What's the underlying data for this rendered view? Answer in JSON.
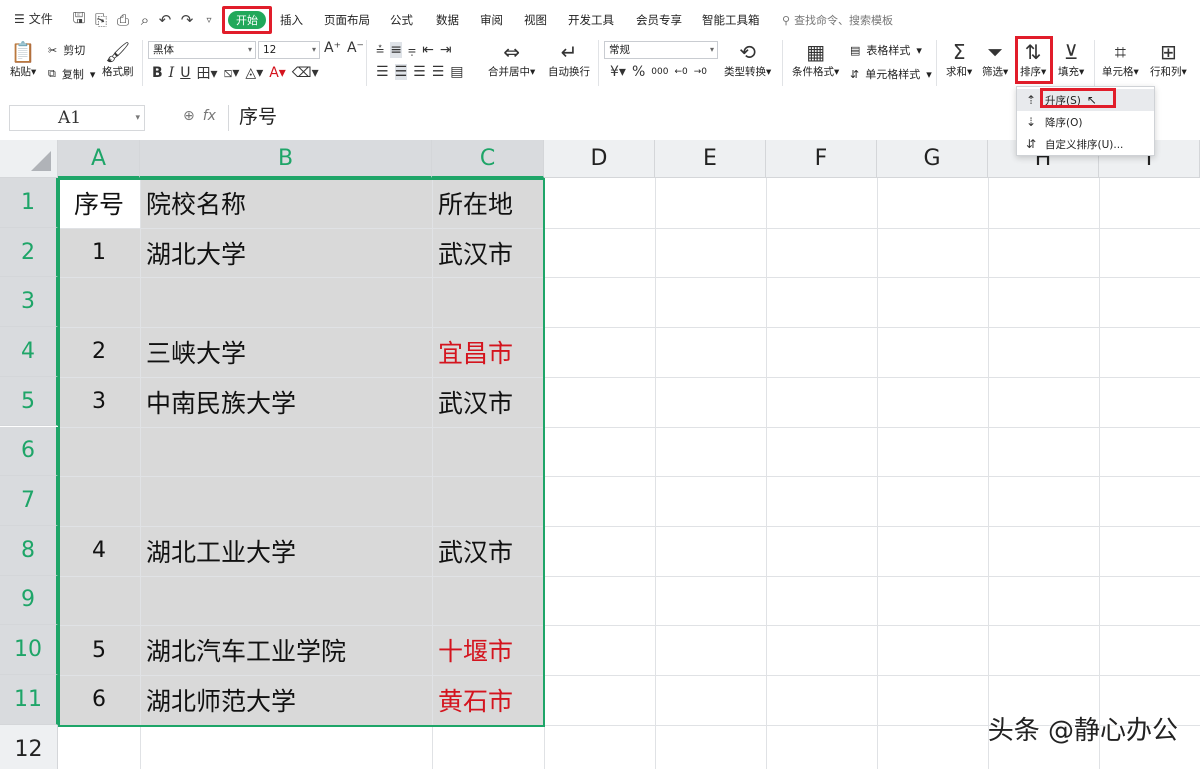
{
  "menubar": {
    "file_label": "文件",
    "tabs": [
      "插入",
      "页面布局",
      "公式",
      "数据",
      "审阅",
      "视图",
      "开发工具",
      "会员专享",
      "智能工具箱"
    ],
    "home_tab": "开始",
    "search_placeholder": "查找命令、搜索模板"
  },
  "ribbon": {
    "paste": "粘贴",
    "cut": "剪切",
    "copy": "复制",
    "format_painter": "格式刷",
    "font_name": "黑体",
    "font_size": "12",
    "merge_center": "合并居中",
    "wrap_text": "自动换行",
    "number_format": "常规",
    "type_convert": "类型转换",
    "conditional_format": "条件格式",
    "table_style": "表格样式",
    "cell_style": "单元格样式",
    "sum": "求和",
    "filter": "筛选",
    "sort": "排序",
    "fill": "填充",
    "cell": "单元格",
    "row_col": "行和列"
  },
  "sort_menu": {
    "ascending": "升序(S)",
    "descending": "降序(O)",
    "custom": "自定义排序(U)..."
  },
  "formula_bar": {
    "name_box": "A1",
    "content": "序号"
  },
  "grid": {
    "columns": [
      "A",
      "B",
      "C",
      "D",
      "E",
      "F",
      "G",
      "H",
      "I"
    ],
    "rows": [
      "1",
      "2",
      "3",
      "4",
      "5",
      "6",
      "7",
      "8",
      "9",
      "10",
      "11",
      "12"
    ],
    "cells": [
      {
        "a": "序号",
        "b": "院校名称",
        "c": "所在地",
        "c_red": false
      },
      {
        "a": "1",
        "b": "湖北大学",
        "c": "武汉市",
        "c_red": false
      },
      {
        "a": "",
        "b": "",
        "c": "",
        "c_red": false
      },
      {
        "a": "2",
        "b": "三峡大学",
        "c": "宜昌市",
        "c_red": true
      },
      {
        "a": "3",
        "b": "中南民族大学",
        "c": "武汉市",
        "c_red": false
      },
      {
        "a": "",
        "b": "",
        "c": "",
        "c_red": false
      },
      {
        "a": "",
        "b": "",
        "c": "",
        "c_red": false
      },
      {
        "a": "4",
        "b": "湖北工业大学",
        "c": "武汉市",
        "c_red": false
      },
      {
        "a": "",
        "b": "",
        "c": "",
        "c_red": false
      },
      {
        "a": "5",
        "b": "湖北汽车工业学院",
        "c": "十堰市",
        "c_red": true
      },
      {
        "a": "6",
        "b": "湖北师范大学",
        "c": "黄石市",
        "c_red": true
      }
    ]
  },
  "watermark": "头条 @静心办公",
  "colors": {
    "accent_green": "#1ea568",
    "highlight_red": "#e11d2a",
    "text_red": "#d4141e"
  }
}
